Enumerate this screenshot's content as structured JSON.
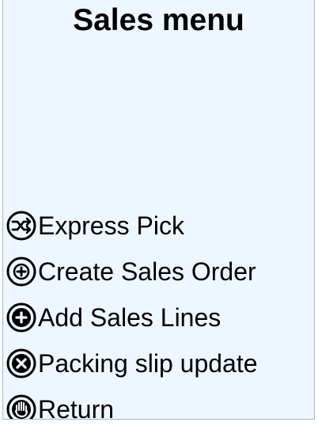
{
  "page": {
    "title": "Sales menu"
  },
  "menu": {
    "items": [
      {
        "label": "Express Pick",
        "icon": "shuffle-icon"
      },
      {
        "label": "Create Sales Order",
        "icon": "target-plus-icon"
      },
      {
        "label": "Add Sales Lines",
        "icon": "plus-circle-icon"
      },
      {
        "label": "Packing slip update",
        "icon": "close-circle-icon"
      },
      {
        "label": "Return",
        "icon": "hand-stop-icon"
      }
    ]
  },
  "colors": {
    "background": "#eef7ff",
    "text": "#000000",
    "border": "#a9b7c6"
  }
}
